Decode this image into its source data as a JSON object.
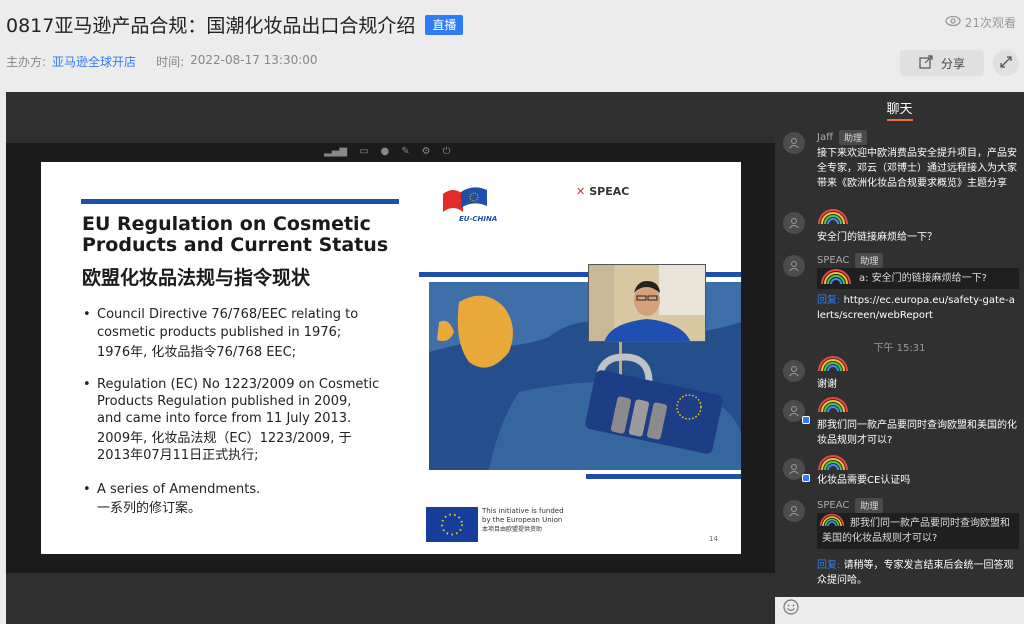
{
  "header": {
    "title": "0817亚马逊产品合规：国潮化妆品出口合规介绍",
    "live_badge": "直播",
    "viewers": "21次观看",
    "host_label": "主办方:",
    "host_name": "亚马逊全球开店",
    "time_label": "时间:",
    "time_value": "2022-08-17 13:30:00",
    "share_label": "分享"
  },
  "slide": {
    "title": "EU Regulation on Cosmetic Products and Current Status",
    "title_cn": "欧盟化妆品法规与指令现状",
    "bullets": [
      {
        "en1": "Council Directive 76/768/EEC relating to",
        "en2": "cosmetic products published in 1976;",
        "cn1": "1976年, 化妆品指令76/768 EEC;",
        "cn2": ""
      },
      {
        "en1": "Regulation (EC) No 1223/2009 on Cosmetic",
        "en2": "Products Regulation published in 2009,",
        "en3": "and came into force from 11 July 2013.",
        "cn1": "2009年, 化妆品法规（EC）1223/2009, 于",
        "cn2": "2013年07月11日正式执行;"
      },
      {
        "en1": "A series of Amendments.",
        "cn1": "一系列的修订案。"
      }
    ],
    "eu_china_label": "EU-CHINA",
    "speac_label": "SPEAC",
    "funded_en1": "This initiative is funded",
    "funded_en2": "by the European Union",
    "funded_cn": "本项目由欧盟提供资助",
    "page_number": "14"
  },
  "chat": {
    "tab_label": "聊天",
    "messages": [
      {
        "name": "Jaff",
        "role": "助理",
        "text": "接下来欢迎中欧消费品安全提升项目，产品安全专家，邓云（邓博士）通过远程接入为大家带来《欧洲化妆品合规要求概览》主题分享"
      },
      {
        "text": "安全门的链接麻烦给一下？"
      },
      {
        "name": "SPEAC",
        "role": "助理",
        "quote": "a: 安全门的链接麻烦给一下?",
        "reply_label": "回复:",
        "reply_text": "https://ec.europa.eu/safety-gate-alerts/screen/webReport"
      },
      {
        "text": "谢谢"
      },
      {
        "text": "那我们同一款产品要同时查询欧盟和美国的化妆品规则才可以?"
      },
      {
        "text": "化妆品需要CE认证吗"
      },
      {
        "name": "SPEAC",
        "role": "助理",
        "quote": "那我们同一款产品要同时查询欧盟和美国的化妆品规则才可以?",
        "reply_label": "回复:",
        "reply_text": "请稍等，专家发言结束后会统一回答观众提问哈。"
      }
    ],
    "timestamp": "下午 15:31"
  },
  "icons": [
    "eye-icon",
    "share-icon",
    "expand-icon",
    "emoji-icon",
    "user-avatar-icon"
  ],
  "colors": {
    "accent": "#2f7cf6",
    "chat_bg": "#303030",
    "tab_underline": "#f26b3a",
    "eu_blue": "#1f4fa8"
  }
}
